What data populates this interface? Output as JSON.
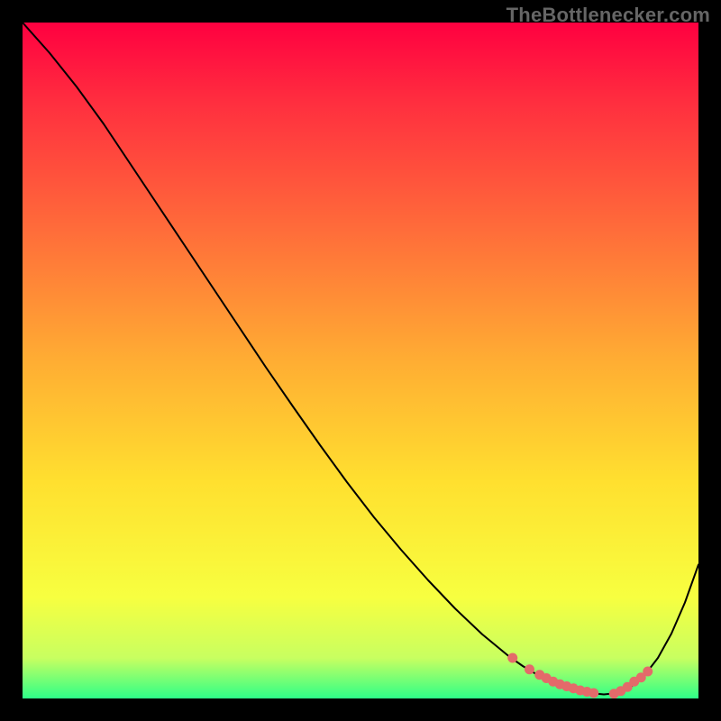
{
  "watermark": "TheBottlenecker.com",
  "colors": {
    "curve_stroke": "#000000",
    "marker_fill": "#e46a6a",
    "gradient_stops": [
      {
        "offset": 0,
        "color": "#ff0040"
      },
      {
        "offset": 12,
        "color": "#ff2f3f"
      },
      {
        "offset": 30,
        "color": "#ff6a3a"
      },
      {
        "offset": 50,
        "color": "#ffad33"
      },
      {
        "offset": 68,
        "color": "#ffe02f"
      },
      {
        "offset": 85,
        "color": "#f7ff40"
      },
      {
        "offset": 94,
        "color": "#c8ff60"
      },
      {
        "offset": 100,
        "color": "#2eff88"
      }
    ]
  },
  "chart_data": {
    "type": "line",
    "title": "",
    "xlabel": "",
    "ylabel": "",
    "xlim": [
      0,
      100
    ],
    "ylim": [
      0,
      100
    ],
    "x": [
      0,
      4,
      8,
      12,
      16,
      20,
      24,
      28,
      32,
      36,
      40,
      44,
      48,
      52,
      56,
      60,
      64,
      68,
      72,
      74,
      76,
      78,
      80,
      82,
      84,
      86,
      88,
      90,
      92,
      94,
      96,
      98,
      100
    ],
    "y": [
      100,
      95.5,
      90.5,
      85,
      79,
      73,
      67,
      61,
      55,
      49,
      43.2,
      37.5,
      32,
      26.8,
      22,
      17.5,
      13.3,
      9.5,
      6.2,
      4.8,
      3.6,
      2.6,
      1.8,
      1.2,
      0.8,
      0.6,
      0.8,
      1.7,
      3.4,
      6.0,
      9.6,
      14.2,
      19.8
    ],
    "marker_x": [
      72.5,
      75,
      76.5,
      77.5,
      78.5,
      79.5,
      80.5,
      81.5,
      82.5,
      83.5,
      84.5,
      87.5,
      88.5,
      89.5,
      90.5,
      91.5,
      92.5
    ],
    "marker_y": [
      6.0,
      4.3,
      3.5,
      3.0,
      2.5,
      2.1,
      1.8,
      1.5,
      1.2,
      1.0,
      0.8,
      0.7,
      1.1,
      1.7,
      2.5,
      3.1,
      4.0
    ]
  }
}
